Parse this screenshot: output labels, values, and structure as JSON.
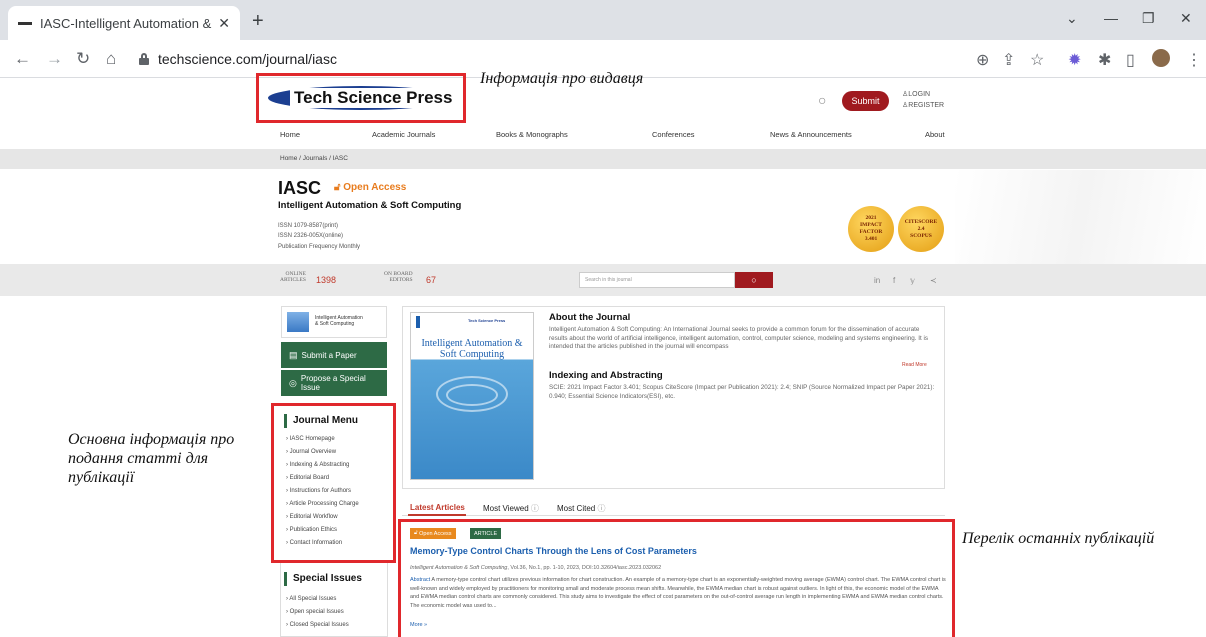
{
  "browser": {
    "tab_title": "IASC-Intelligent Automation & So",
    "url": "techscience.com/journal/iasc"
  },
  "site": {
    "logo_text": "Tech Science Press",
    "submit_label": "Submit",
    "login": "LOGIN",
    "register": "REGISTER",
    "nav": [
      "Home",
      "Academic Journals",
      "Books & Monographs",
      "Conferences",
      "News & Announcements",
      "About"
    ],
    "breadcrumb": "Home / Journals / IASC"
  },
  "annotations": {
    "publisher_info": "Інформація про видавця",
    "submission_info": "Основна інформація про подання статті для публікації",
    "latest_list": "Перелік останніх публікацій"
  },
  "journal": {
    "abbr": "IASC",
    "open_access": "Open Access",
    "name": "Intelligent Automation & Soft Computing",
    "issn_print": "ISSN 1079-8587(print)",
    "issn_online": "ISSN 2326-005X(online)",
    "frequency": "Publication Frequency Monthly",
    "impact_badge": [
      "2021",
      "IMPACT",
      "FACTOR",
      "3.401"
    ],
    "citescore_badge": [
      "CITESCORE",
      "2.4",
      "SCOPUS"
    ]
  },
  "stats": {
    "online_label_1": "ONLINE",
    "online_label_2": "ARTICLES",
    "online_value": "1398",
    "board_label_1": "ON BOARD",
    "board_label_2": "EDITORS",
    "board_value": "67",
    "search_placeholder": "Search in this journal"
  },
  "sidebar": {
    "mini_title_1": "Intelligent Automation",
    "mini_title_2": "& Soft Computing",
    "submit_paper": "Submit a Paper",
    "propose_issue": "Propose a Special Issue",
    "menu_title": "Journal Menu",
    "menu_items": [
      "IASC Homepage",
      "Journal Overview",
      "Indexing & Abstracting",
      "Editorial Board",
      "Instructions for Authors",
      "Article Processing Charge",
      "Editorial Workflow",
      "Publication Ethics",
      "Contact Information"
    ],
    "special_title": "Special Issues",
    "special_items": [
      "All Special Issues",
      "Open special Issues",
      "Closed Special Issues"
    ]
  },
  "about": {
    "cover_logo": "Tech Science Press",
    "cover_title": "Intelligent Automation & Soft Computing",
    "heading": "About the Journal",
    "text": "Intelligent Automation & Soft Computing: An International Journal seeks to provide a common forum for the dissemination of accurate results about the world of artificial intelligence, intelligent automation, control, computer science, modeling and systems engineering. It is intended that the articles published in the journal will encompass",
    "read_more": "Read More",
    "indexing_heading": "Indexing and Abstracting",
    "indexing_text": "SCIE: 2021 Impact Factor 3.401; Scopus CiteScore (Impact per Publication 2021): 2.4; SNIP (Source Normalized Impact per Paper 2021): 0.940; Essential Science Indicators(ESI), etc."
  },
  "tabs": {
    "latest": "Latest Articles",
    "viewed": "Most Viewed",
    "cited": "Most Cited"
  },
  "article": {
    "tag_oa": "Open Access",
    "tag_type": "ARTICLE",
    "title": "Memory-Type Control Charts Through the Lens of Cost Parameters",
    "meta_journal": "Intelligent Automation & Soft Computing",
    "meta_rest": ", Vol.36, No.1, pp. 1-10, 2023, DOI:10.32604/iasc.2023.032062",
    "abstract_label": "Abstract",
    "abstract": " A memory-type control chart utilizes previous information for chart construction. An example of a memory-type chart is an exponentially-weighted moving average (EWMA) control chart. The EWMA control chart is well-known and widely employed by practitioners for monitoring small and moderate process mean shifts. Meanwhile, the EWMA median chart is robust against outliers. In light of this, the economic model of the EWMA and EWMA median control charts are commonly considered. This study aims to investigate the effect of cost parameters on the out-of-control average run length in implementing EWMA and EWMA median control charts. The economic model was used to...",
    "more": "More »"
  }
}
